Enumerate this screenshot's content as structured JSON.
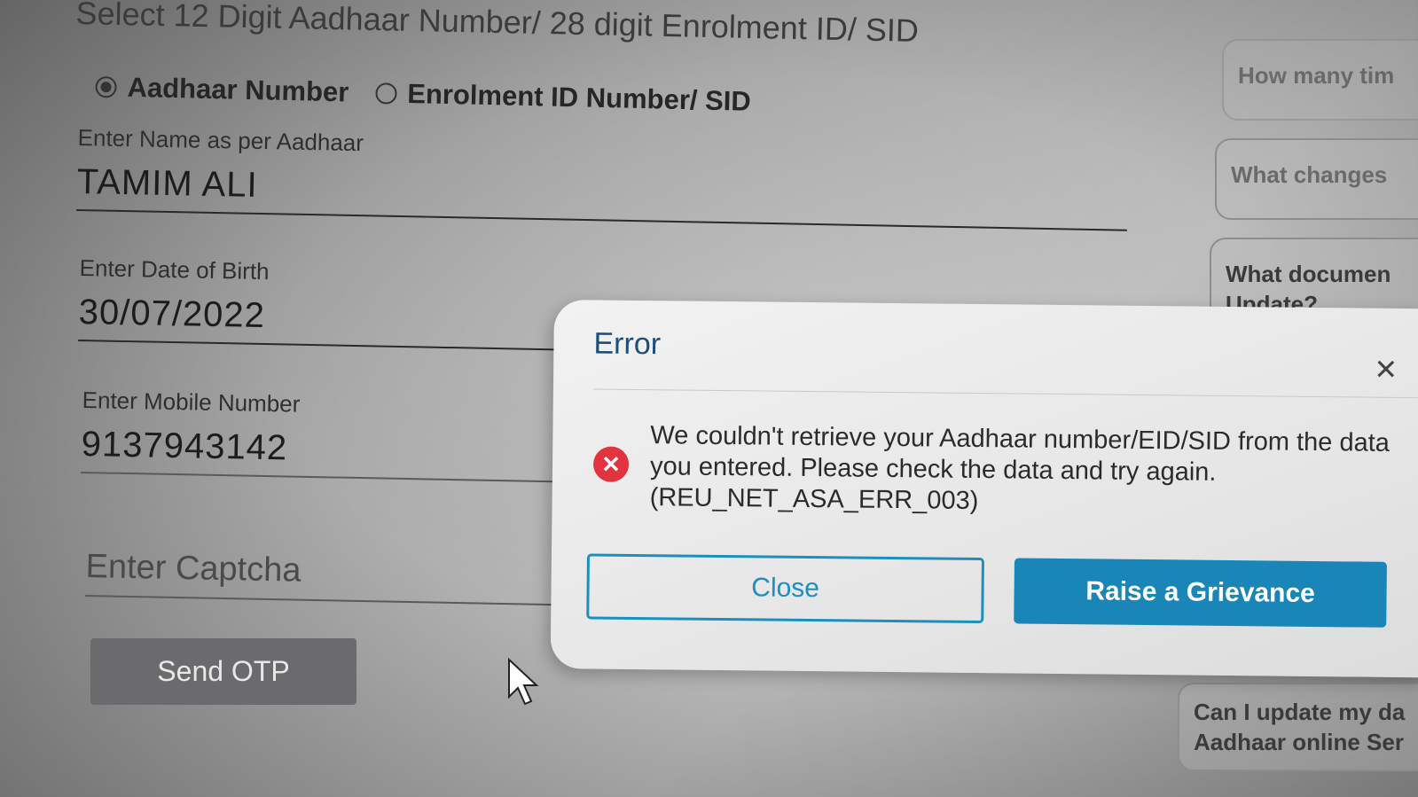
{
  "form": {
    "heading": "Select 12 Digit Aadhaar Number/ 28 digit Enrolment ID/ SID",
    "radio_options": [
      {
        "label": "Aadhaar Number",
        "selected": true
      },
      {
        "label": "Enrolment ID Number/ SID",
        "selected": false
      }
    ],
    "name": {
      "label": "Enter Name as per Aadhaar",
      "value": "TAMIM ALI"
    },
    "dob": {
      "label": "Enter Date of Birth",
      "value": "30/07/2022"
    },
    "mobile": {
      "label": "Enter Mobile Number",
      "value": "9137943142"
    },
    "captcha": {
      "placeholder": "Enter Captcha"
    },
    "send_otp_label": "Send OTP"
  },
  "sidebar": {
    "cards": [
      {
        "line1": "How many tim",
        "line2": ""
      },
      {
        "line1": "What changes",
        "line2": ""
      },
      {
        "line1": "What documen",
        "line2": "Update?"
      },
      {
        "line1": "Can I update my da",
        "line2": "Aadhaar online Ser"
      }
    ]
  },
  "dialog": {
    "title": "Error",
    "close_icon": "close-icon",
    "error_icon": "error-circle-icon",
    "message": "We couldn't retrieve your Aadhaar number/EID/SID from the data you entered. Please check the data and try again. (REU_NET_ASA_ERR_003)",
    "close_label": "Close",
    "grievance_label": "Raise a Grievance"
  },
  "colors": {
    "accent": "#1a86b8",
    "error": "#e2343f",
    "title": "#1d4e7a"
  }
}
